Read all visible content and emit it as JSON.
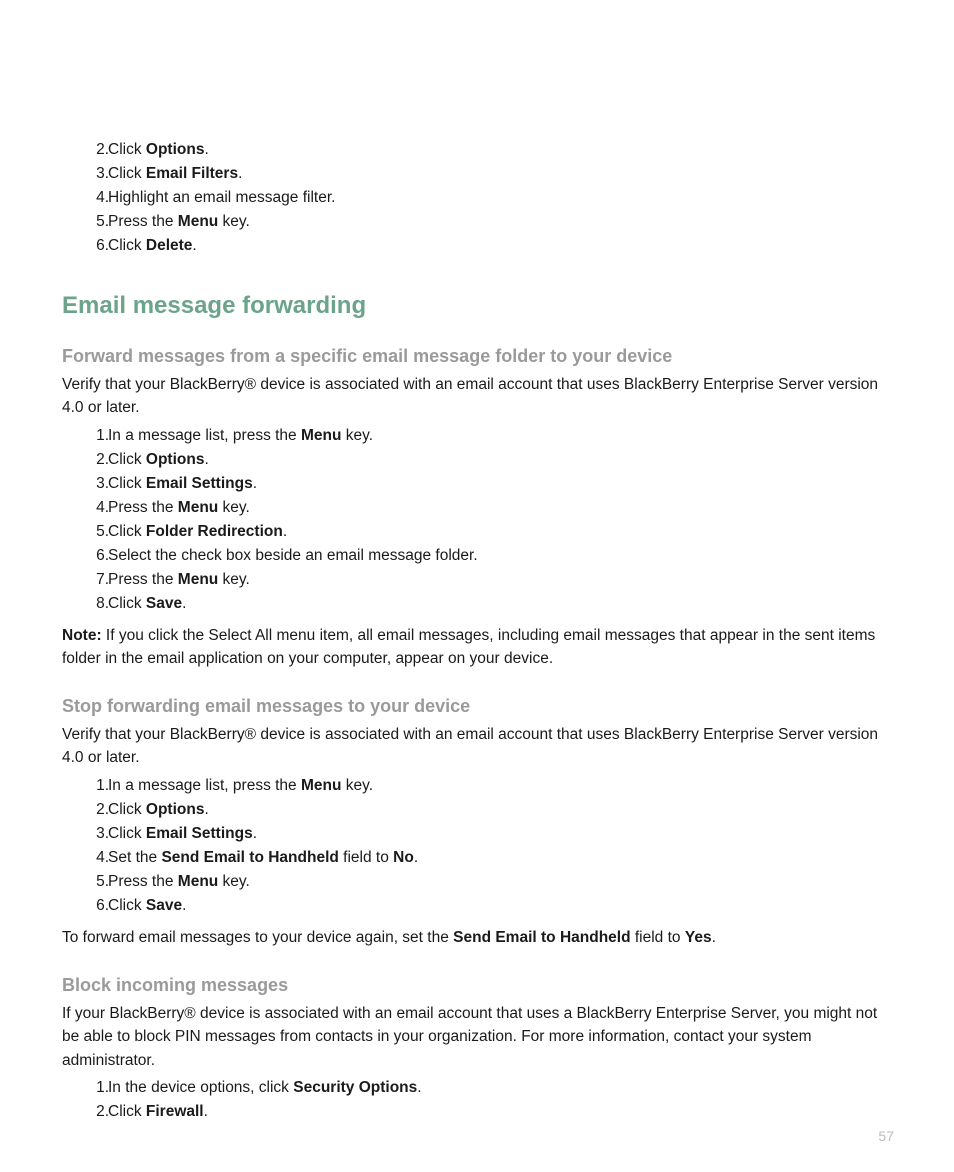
{
  "top_list_start": 1,
  "top_list": [
    [
      [
        "Click "
      ],
      [
        "b",
        "Options"
      ],
      [
        "."
      ]
    ],
    [
      [
        "Click "
      ],
      [
        "b",
        "Email Filters"
      ],
      [
        "."
      ]
    ],
    [
      [
        "Highlight an email message filter."
      ]
    ],
    [
      [
        "Press the "
      ],
      [
        "b",
        "Menu"
      ],
      [
        " key."
      ]
    ],
    [
      [
        "Click "
      ],
      [
        "b",
        "Delete"
      ],
      [
        "."
      ]
    ]
  ],
  "h1": "Email message forwarding",
  "sections": [
    {
      "h2": "Forward messages from a specific email message folder to your device",
      "intro": [
        [
          "Verify that your BlackBerry® device is associated with an email account that uses BlackBerry Enterprise Server version 4.0 or later."
        ]
      ],
      "list": [
        [
          [
            "In a message list, press the "
          ],
          [
            "b",
            "Menu"
          ],
          [
            " key."
          ]
        ],
        [
          [
            "Click "
          ],
          [
            "b",
            "Options"
          ],
          [
            "."
          ]
        ],
        [
          [
            "Click "
          ],
          [
            "b",
            "Email Settings"
          ],
          [
            "."
          ]
        ],
        [
          [
            "Press the "
          ],
          [
            "b",
            "Menu"
          ],
          [
            " key."
          ]
        ],
        [
          [
            "Click "
          ],
          [
            "b",
            "Folder Redirection"
          ],
          [
            "."
          ]
        ],
        [
          [
            "Select the check box beside an email message folder."
          ]
        ],
        [
          [
            "Press the "
          ],
          [
            "b",
            "Menu"
          ],
          [
            " key."
          ]
        ],
        [
          [
            "Click "
          ],
          [
            "b",
            "Save"
          ],
          [
            "."
          ]
        ]
      ],
      "outro": [
        [
          "b",
          "Note:"
        ],
        [
          "  If you click the Select All menu item, all email messages, including email messages that appear in the sent items folder in the email application on your computer, appear on your device."
        ]
      ]
    },
    {
      "h2": "Stop forwarding email messages to your device",
      "intro": [
        [
          "Verify that your BlackBerry® device is associated with an email account that uses BlackBerry Enterprise Server version 4.0 or later."
        ]
      ],
      "list": [
        [
          [
            "In a message list, press the "
          ],
          [
            "b",
            "Menu"
          ],
          [
            " key."
          ]
        ],
        [
          [
            "Click "
          ],
          [
            "b",
            "Options"
          ],
          [
            "."
          ]
        ],
        [
          [
            "Click "
          ],
          [
            "b",
            "Email Settings"
          ],
          [
            "."
          ]
        ],
        [
          [
            "Set the "
          ],
          [
            "b",
            "Send Email to Handheld"
          ],
          [
            " field to "
          ],
          [
            "b",
            "No"
          ],
          [
            "."
          ]
        ],
        [
          [
            "Press the "
          ],
          [
            "b",
            "Menu"
          ],
          [
            " key."
          ]
        ],
        [
          [
            "Click "
          ],
          [
            "b",
            "Save"
          ],
          [
            "."
          ]
        ]
      ],
      "outro": [
        [
          "To forward email messages to your device again, set the "
        ],
        [
          "b",
          "Send Email to Handheld"
        ],
        [
          " field to "
        ],
        [
          "b",
          "Yes"
        ],
        [
          "."
        ]
      ]
    },
    {
      "h2": "Block incoming messages",
      "intro": [
        [
          "If your BlackBerry® device is associated with an email account that uses a BlackBerry Enterprise Server, you might not be able to block PIN messages from contacts in your organization. For more information, contact your system administrator."
        ]
      ],
      "list": [
        [
          [
            "In the device options, click "
          ],
          [
            "b",
            "Security Options"
          ],
          [
            "."
          ]
        ],
        [
          [
            "Click "
          ],
          [
            "b",
            "Firewall"
          ],
          [
            "."
          ]
        ]
      ]
    }
  ],
  "page_number": "57"
}
